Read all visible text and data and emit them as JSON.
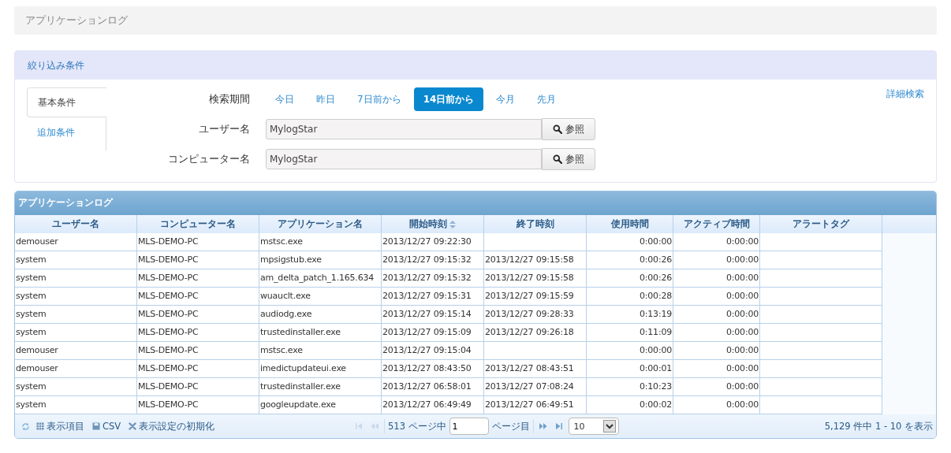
{
  "page_title": "アプリケーションログ",
  "filter": {
    "header": "絞り込み条件",
    "tabs": [
      {
        "label": "基本条件",
        "selected": true
      },
      {
        "label": "追加条件",
        "selected": false
      }
    ],
    "period": {
      "label": "検索期間",
      "options": [
        {
          "label": "今日",
          "selected": false
        },
        {
          "label": "昨日",
          "selected": false
        },
        {
          "label": "7日前から",
          "selected": false
        },
        {
          "label": "14日前から",
          "selected": true
        },
        {
          "label": "今月",
          "selected": false
        },
        {
          "label": "先月",
          "selected": false
        }
      ]
    },
    "fields": [
      {
        "label": "ユーザー名",
        "value": "MylogStar",
        "button": "参照"
      },
      {
        "label": "コンピューター名",
        "value": "MylogStar",
        "button": "参照"
      }
    ],
    "advanced_link": "詳細検索"
  },
  "grid": {
    "title": "アプリケーションログ",
    "columns": [
      {
        "label": "ユーザー名",
        "kind": "text",
        "sorted": false
      },
      {
        "label": "コンピューター名",
        "kind": "text",
        "sorted": false
      },
      {
        "label": "アプリケーション名",
        "kind": "text",
        "sorted": false
      },
      {
        "label": "開始時刻",
        "kind": "text",
        "sorted": true
      },
      {
        "label": "終了時刻",
        "kind": "text",
        "sorted": false
      },
      {
        "label": "使用時間",
        "kind": "number",
        "sorted": false
      },
      {
        "label": "アクティブ時間",
        "kind": "number",
        "sorted": false
      },
      {
        "label": "アラートタグ",
        "kind": "text",
        "sorted": false
      }
    ],
    "rows": [
      [
        "demouser",
        "MLS-DEMO-PC",
        "mstsc.exe",
        "2013/12/27 09:22:30",
        "",
        "0:00:00",
        "0:00:00",
        ""
      ],
      [
        "system",
        "MLS-DEMO-PC",
        "mpsigstub.exe",
        "2013/12/27 09:15:32",
        "2013/12/27 09:15:58",
        "0:00:26",
        "0:00:00",
        ""
      ],
      [
        "system",
        "MLS-DEMO-PC",
        "am_delta_patch_1.165.634",
        "2013/12/27 09:15:32",
        "2013/12/27 09:15:58",
        "0:00:26",
        "0:00:00",
        ""
      ],
      [
        "system",
        "MLS-DEMO-PC",
        "wuauclt.exe",
        "2013/12/27 09:15:31",
        "2013/12/27 09:15:59",
        "0:00:28",
        "0:00:00",
        ""
      ],
      [
        "system",
        "MLS-DEMO-PC",
        "audiodg.exe",
        "2013/12/27 09:15:14",
        "2013/12/27 09:28:33",
        "0:13:19",
        "0:00:00",
        ""
      ],
      [
        "system",
        "MLS-DEMO-PC",
        "trustedinstaller.exe",
        "2013/12/27 09:15:09",
        "2013/12/27 09:26:18",
        "0:11:09",
        "0:00:00",
        ""
      ],
      [
        "demouser",
        "MLS-DEMO-PC",
        "mstsc.exe",
        "2013/12/27 09:15:04",
        "",
        "0:00:00",
        "0:00:00",
        ""
      ],
      [
        "demouser",
        "MLS-DEMO-PC",
        "imedictupdateui.exe",
        "2013/12/27 08:43:50",
        "2013/12/27 08:43:51",
        "0:00:01",
        "0:00:00",
        ""
      ],
      [
        "system",
        "MLS-DEMO-PC",
        "trustedinstaller.exe",
        "2013/12/27 06:58:01",
        "2013/12/27 07:08:24",
        "0:10:23",
        "0:00:00",
        ""
      ],
      [
        "system",
        "MLS-DEMO-PC",
        "googleupdate.exe",
        "2013/12/27 06:49:49",
        "2013/12/27 06:49:51",
        "0:00:02",
        "0:00:00",
        ""
      ]
    ]
  },
  "pager": {
    "tools": [
      {
        "kind": "columns",
        "label": "表示項目"
      },
      {
        "kind": "save",
        "label": "CSV"
      },
      {
        "kind": "reset",
        "label": "表示設定の初期化"
      }
    ],
    "nav_before": [
      {
        "kind": "first",
        "disabled": true
      },
      {
        "kind": "prev",
        "disabled": true
      }
    ],
    "page_total": "513 ページ中",
    "page": "1",
    "page_suffix": "ページ目",
    "nav_after": [
      {
        "kind": "next",
        "disabled": false
      },
      {
        "kind": "last",
        "disabled": false
      }
    ],
    "page_size": "10",
    "summary": "5,129 件中 1 - 10 を表示"
  }
}
